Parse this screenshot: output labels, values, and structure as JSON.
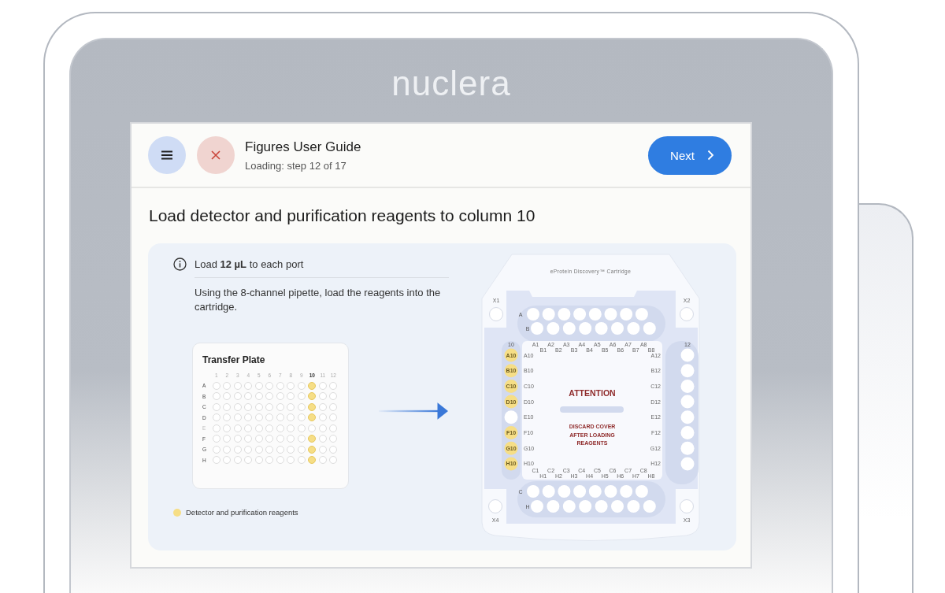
{
  "device": {
    "logo": "nuclera"
  },
  "header": {
    "title": "Figures User Guide",
    "subtitle": "Loading: step 12 of 17",
    "next_button": "Next"
  },
  "heading": "Load detector and purification reagents to column 10",
  "instruction": {
    "note": "Load **12 µL** to each port",
    "text": "Using the 8-channel pipette, load the reagents into the cartridge."
  },
  "transfer_plate": {
    "title": "Transfer Plate",
    "columns": [
      "1",
      "2",
      "3",
      "4",
      "5",
      "6",
      "7",
      "8",
      "9",
      "10",
      "11",
      "12"
    ],
    "rows": [
      {
        "label": "A",
        "disabled": false,
        "filled": [
          false,
          false,
          false,
          false,
          false,
          false,
          false,
          false,
          false,
          true,
          false,
          false
        ]
      },
      {
        "label": "B",
        "disabled": false,
        "filled": [
          false,
          false,
          false,
          false,
          false,
          false,
          false,
          false,
          false,
          true,
          false,
          false
        ]
      },
      {
        "label": "C",
        "disabled": false,
        "filled": [
          false,
          false,
          false,
          false,
          false,
          false,
          false,
          false,
          false,
          true,
          false,
          false
        ]
      },
      {
        "label": "D",
        "disabled": false,
        "filled": [
          false,
          false,
          false,
          false,
          false,
          false,
          false,
          false,
          false,
          true,
          false,
          false
        ]
      },
      {
        "label": "E",
        "disabled": true,
        "filled": [
          false,
          false,
          false,
          false,
          false,
          false,
          false,
          false,
          false,
          false,
          false,
          false
        ]
      },
      {
        "label": "F",
        "disabled": false,
        "filled": [
          false,
          false,
          false,
          false,
          false,
          false,
          false,
          false,
          false,
          true,
          false,
          false
        ]
      },
      {
        "label": "G",
        "disabled": false,
        "filled": [
          false,
          false,
          false,
          false,
          false,
          false,
          false,
          false,
          false,
          true,
          false,
          false
        ]
      },
      {
        "label": "H",
        "disabled": false,
        "filled": [
          false,
          false,
          false,
          false,
          false,
          false,
          false,
          false,
          false,
          true,
          false,
          false
        ]
      }
    ]
  },
  "legend": {
    "label": "Detector and purification reagents",
    "color": "#f6de86"
  },
  "cartridge": {
    "title": "eProtein Discovery™ Cartridge",
    "corner_ports": [
      {
        "label": "X1"
      },
      {
        "label": "X2"
      },
      {
        "label": "X4"
      },
      {
        "label": "X3"
      }
    ],
    "top_rows": [
      {
        "label": "A",
        "ports": [
          false,
          false,
          false,
          false,
          false,
          false,
          false,
          false
        ]
      },
      {
        "label": "B",
        "ports": [
          false,
          false,
          false,
          false,
          false,
          false,
          false,
          false
        ]
      }
    ],
    "bottom_rows": [
      {
        "label": "C",
        "ports": [
          false,
          false,
          false,
          false,
          false,
          false,
          false,
          false
        ]
      },
      {
        "label": "H",
        "ports": [
          false,
          false,
          false,
          false,
          false,
          false,
          false,
          false
        ]
      }
    ],
    "left_column": {
      "label": "10",
      "ports": [
        {
          "label": "A10",
          "filled": true
        },
        {
          "label": "B10",
          "filled": true
        },
        {
          "label": "C10",
          "filled": true
        },
        {
          "label": "D10",
          "filled": true
        },
        {
          "filled": false
        },
        {
          "label": "F10",
          "filled": true
        },
        {
          "label": "G10",
          "filled": true
        },
        {
          "label": "H10",
          "filled": true
        }
      ]
    },
    "right_column": {
      "label": "12",
      "ports": [
        {
          "filled": false
        },
        {
          "filled": false
        },
        {
          "filled": false
        },
        {
          "filled": false
        },
        {
          "filled": false
        },
        {
          "filled": false
        },
        {
          "filled": false
        },
        {
          "filled": false
        }
      ]
    },
    "inner_top_labels": [
      "A1",
      "B1",
      "A2",
      "B2",
      "A3",
      "B3",
      "A4",
      "B4",
      "A5",
      "B5",
      "A6",
      "B6",
      "A7",
      "B7",
      "A8",
      "B8"
    ],
    "inner_bottom_labels": [
      "C1",
      "H1",
      "C2",
      "H2",
      "C3",
      "H3",
      "C4",
      "H4",
      "C5",
      "H5",
      "C6",
      "H6",
      "C7",
      "H7",
      "C8",
      "H8"
    ],
    "inner_left_labels": [
      "A10",
      "B10",
      "C10",
      "D10",
      "E10",
      "F10",
      "G10",
      "H10"
    ],
    "inner_right_labels": [
      "A12",
      "B12",
      "C12",
      "D12",
      "E12",
      "F12",
      "G12",
      "H12"
    ],
    "attention": "ATTENTION",
    "message_lines": [
      "DISCARD COVER",
      "AFTER LOADING",
      "REAGENTS"
    ]
  }
}
